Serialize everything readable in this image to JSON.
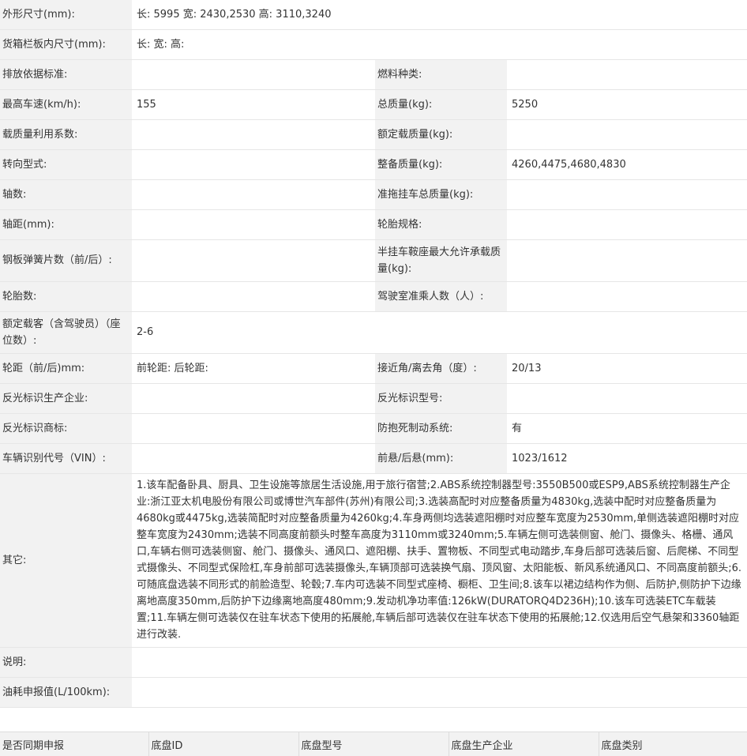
{
  "rows": {
    "dims": {
      "label": "外形尺寸(mm):",
      "value": "长:  5995 宽:  2430,2530 高:  3110,3240"
    },
    "cargo": {
      "label": "货箱栏板内尺寸(mm):",
      "value": "长:   宽:   高:"
    },
    "emission": {
      "label": "排放依据标准:",
      "value": "",
      "label2": "燃料种类:",
      "value2": ""
    },
    "speed": {
      "label": "最高车速(km/h):",
      "value": "155",
      "label2": "总质量(kg):",
      "value2": "5250"
    },
    "load_coef": {
      "label": "载质量利用系数:",
      "value": "",
      "label2": "额定载质量(kg):",
      "value2": ""
    },
    "steering": {
      "label": "转向型式:",
      "value": "",
      "label2": "整备质量(kg):",
      "value2": "4260,4475,4680,4830"
    },
    "axles": {
      "label": "轴数:",
      "value": "",
      "label2": "准拖挂车总质量(kg):",
      "value2": ""
    },
    "wheelbase": {
      "label": "轴距(mm):",
      "value": "",
      "label2": "轮胎规格:",
      "value2": ""
    },
    "springs": {
      "label": "钢板弹簧片数（前/后）:",
      "value": "",
      "label2": "半挂车鞍座最大允许承载质量(kg):",
      "value2": ""
    },
    "tires": {
      "label": "轮胎数:",
      "value": "",
      "label2": "驾驶室准乘人数（人）:",
      "value2": ""
    },
    "seats": {
      "label": "额定载客（含驾驶员）（座位数）:",
      "value": "2-6"
    },
    "track": {
      "label": "轮距（前/后)mm:",
      "value": "前轮距:  后轮距:",
      "label2": "接近角/离去角（度）:",
      "value2": "20/13"
    },
    "reflect_maker": {
      "label": "反光标识生产企业:",
      "value": "",
      "label2": "反光标识型号:",
      "value2": ""
    },
    "reflect_brand": {
      "label": "反光标识商标:",
      "value": "",
      "label2": "防抱死制动系统:",
      "value2": "有"
    },
    "vin": {
      "label": "车辆识别代号（VIN）:",
      "value": "",
      "label2": "前悬/后悬(mm):",
      "value2": "1023/1612"
    },
    "other": {
      "label": "其它:",
      "value": "1.该车配备卧具、厨具、卫生设施等旅居生活设施,用于旅行宿营;2.ABS系统控制器型号:3550B500或ESP9,ABS系统控制器生产企业:浙江亚太机电股份有限公司或博世汽车部件(苏州)有限公司;3.选装高配时对应整备质量为4830kg,选装中配时对应整备质量为4680kg或4475kg,选装简配时对应整备质量为4260kg;4.车身两侧均选装遮阳棚时对应整车宽度为2530mm,单侧选装遮阳棚时对应整车宽度为2430mm;选装不同高度前额头时整车高度为3110mm或3240mm;5.车辆左侧可选装侧窗、舱门、摄像头、格栅、通风口,车辆右侧可选装侧窗、舱门、摄像头、通风口、遮阳棚、扶手、置物板、不同型式电动踏步,车身后部可选装后窗、后爬梯、不同型式摄像头、不同型式保险杠,车身前部可选装摄像头,车辆顶部可选装换气扇、顶风窗、太阳能板、新风系统通风口、不同高度前额头;6.可随底盘选装不同形式的前脸造型、轮毂;7.车内可选装不同型式座椅、橱柜、卫生间;8.该车以裙边结构作为侧、后防护,侧防护下边缘离地高度350mm,后防护下边缘离地高度480mm;9.发动机净功率值:126kW(DURATORQ4D236H);10.该车可选装ETC车载装置;11.车辆左侧可选装仅在驻车状态下使用的拓展舱,车辆后部可选装仅在驻车状态下使用的拓展舱;12.仅选用后空气悬架和3360轴距进行改装."
    },
    "remark": {
      "label": "说明:",
      "value": ""
    },
    "fuel": {
      "label": "油耗申报值(L/100km):",
      "value": ""
    }
  },
  "chassis_headers": [
    "是否同期申报",
    "底盘ID",
    "底盘型号",
    "底盘生产企业",
    "底盘类别"
  ]
}
